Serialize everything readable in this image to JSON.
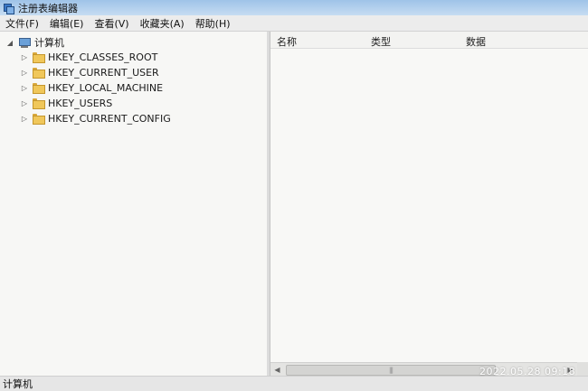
{
  "window": {
    "title": "注册表编辑器",
    "icon": "regedit-icon"
  },
  "menu": {
    "items": [
      {
        "label": "文件(F)"
      },
      {
        "label": "编辑(E)"
      },
      {
        "label": "查看(V)"
      },
      {
        "label": "收藏夹(A)"
      },
      {
        "label": "帮助(H)"
      }
    ]
  },
  "tree": {
    "root": {
      "label": "计算机",
      "expanded": true,
      "icon": "computer-icon"
    },
    "children": [
      {
        "label": "HKEY_CLASSES_ROOT",
        "icon": "folder-icon"
      },
      {
        "label": "HKEY_CURRENT_USER",
        "icon": "folder-icon"
      },
      {
        "label": "HKEY_LOCAL_MACHINE",
        "icon": "folder-icon"
      },
      {
        "label": "HKEY_USERS",
        "icon": "folder-icon"
      },
      {
        "label": "HKEY_CURRENT_CONFIG",
        "icon": "folder-icon"
      }
    ]
  },
  "list": {
    "columns": [
      {
        "label": "名称"
      },
      {
        "label": "类型"
      },
      {
        "label": "数据"
      }
    ],
    "rows": []
  },
  "status": {
    "text": "计算机"
  },
  "photo_timestamp": "2022.05.28  09:18"
}
